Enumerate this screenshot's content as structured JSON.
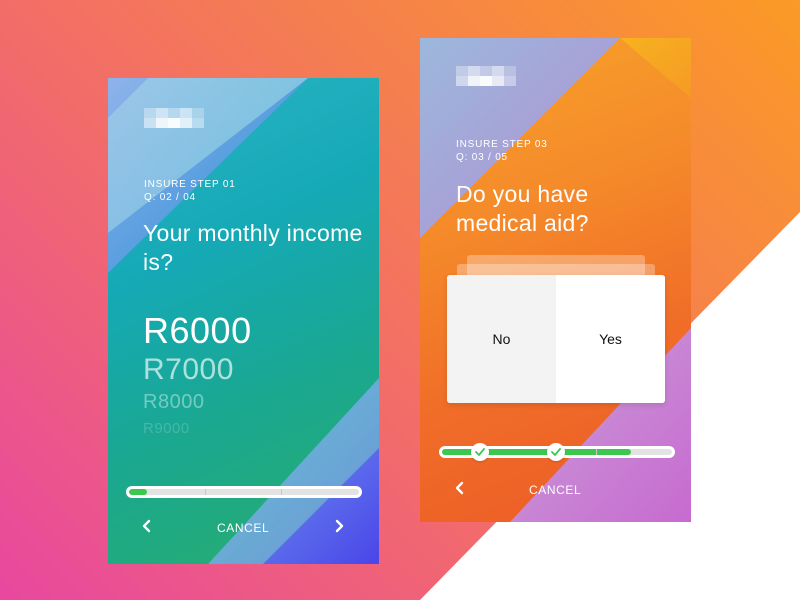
{
  "colors": {
    "background_start": "#e8489f",
    "background_end": "#fb9a25",
    "card1_primary": "#15a9b6",
    "card2_primary": "#f58a2a",
    "progress_fill": "#3cc84f",
    "white": "#ffffff"
  },
  "card1": {
    "step": "INSURE STEP 01",
    "question_number": "Q: 02 / 04",
    "question": "Your monthly income is?",
    "amounts": [
      "R6000",
      "R7000",
      "R8000",
      "R9000"
    ],
    "progress": 0.08,
    "prev_icon": "chevron-left-icon",
    "next_icon": "chevron-right-icon",
    "cancel": "CANCEL"
  },
  "card2": {
    "step": "INSURE STEP 03",
    "question_number": "Q: 03 / 05",
    "question": "Do you have medical aid?",
    "options": {
      "no": "No",
      "yes": "Yes"
    },
    "progress": 0.82,
    "completed_checkpoints": [
      "check-icon",
      "check-icon"
    ],
    "prev_icon": "chevron-left-icon",
    "cancel": "CANCEL"
  }
}
